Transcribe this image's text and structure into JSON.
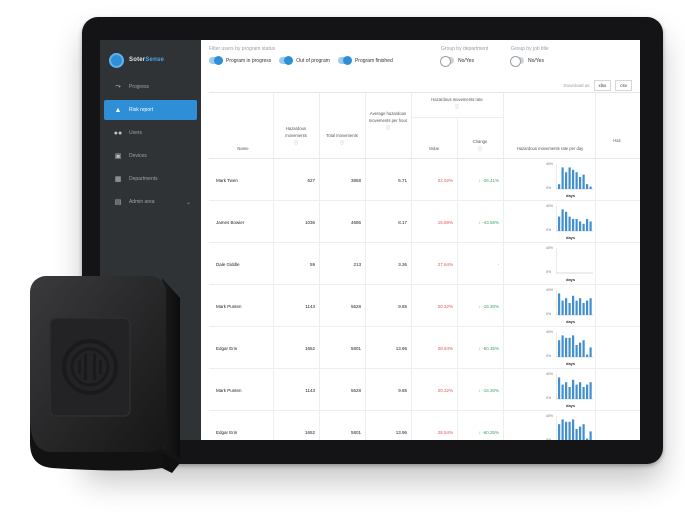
{
  "brand": {
    "name_a": "Soter",
    "name_b": "Sense"
  },
  "sidebar": {
    "items": [
      {
        "label": "Progress",
        "icon": "trend-icon",
        "active": false
      },
      {
        "label": "Risk report",
        "icon": "warning-icon",
        "active": true
      },
      {
        "label": "Users",
        "icon": "users-icon",
        "active": false
      },
      {
        "label": "Devices",
        "icon": "devices-icon",
        "active": false
      },
      {
        "label": "Departments",
        "icon": "building-icon",
        "active": false
      },
      {
        "label": "Admin area",
        "icon": "admin-icon",
        "active": false
      }
    ]
  },
  "filters": {
    "title": "Filter users by program status",
    "options": [
      "Program in progress",
      "Out of program",
      "Program finished"
    ]
  },
  "group_department": {
    "title": "Group by department",
    "label": "No/Yes"
  },
  "group_job": {
    "title": "Group by job title",
    "label": "No/Yes"
  },
  "download": {
    "label": "Download as",
    "xlsx": "xlsx",
    "csv": "csv"
  },
  "table": {
    "headers": {
      "name": "Name",
      "hazardous": "Hazardous movements",
      "total": "Total movements",
      "avg": "Average hazardous movements per hour",
      "rate_group": "Hazardous movements rate",
      "value": "Value",
      "change": "Change",
      "per_day": "Hazardous movements rate per day",
      "extra": "Haz"
    },
    "info_glyph": "ⓘ",
    "chart_axis": {
      "top": "40%",
      "bottom": "0%",
      "label": "days"
    },
    "rows": [
      {
        "name": "Mark Twen",
        "hazardous": "627",
        "total": "3858",
        "avg": "6.71",
        "value": "22.02%",
        "change": "↓ -26.41%",
        "bars": [
          2,
          9,
          7,
          9,
          8,
          7,
          5,
          6,
          2,
          1
        ]
      },
      {
        "name": "James Bowier",
        "hazardous": "1036",
        "total": "4686",
        "avg": "8.17",
        "value": "15.68%",
        "change": "↓ -43.66%",
        "bars": [
          6,
          9,
          8,
          6,
          5,
          5,
          4,
          3,
          5,
          4
        ]
      },
      {
        "name": "Dale Giddle",
        "hazardous": "59",
        "total": "213",
        "avg": "3.36",
        "value": "27.64%",
        "change": "-",
        "bars": [
          0,
          0,
          0,
          0,
          0,
          0,
          0,
          0,
          0,
          0
        ]
      },
      {
        "name": "Mark Punten",
        "hazardous": "1143",
        "total": "5628",
        "avg": "9.85",
        "value": "20.32%",
        "change": "↓ -16.30%",
        "bars": [
          9,
          6,
          7,
          5,
          8,
          6,
          7,
          5,
          6,
          7
        ]
      },
      {
        "name": "Edgar Erin",
        "hazardous": "1652",
        "total": "5801",
        "avg": "13.96",
        "value": "28.54%",
        "change": "↓ -60.35%",
        "bars": [
          7,
          9,
          8,
          8,
          9,
          5,
          6,
          7,
          1,
          4
        ]
      },
      {
        "name": "Mark Punten",
        "hazardous": "1143",
        "total": "5628",
        "avg": "9.85",
        "value": "20.32%",
        "change": "↓ -16.30%",
        "bars": [
          9,
          6,
          7,
          5,
          8,
          6,
          7,
          5,
          6,
          7
        ]
      },
      {
        "name": "Edgar Erin",
        "hazardous": "1652",
        "total": "5801",
        "avg": "13.96",
        "value": "28.54%",
        "change": "↓ -60.35%",
        "bars": [
          7,
          9,
          8,
          8,
          9,
          5,
          6,
          7,
          1,
          4
        ]
      }
    ]
  },
  "colors": {
    "accent": "#2f8fd6",
    "sidebar": "#2f3336",
    "red": "#e55353",
    "green": "#3ea36a",
    "bar": "#3f8fd1"
  }
}
